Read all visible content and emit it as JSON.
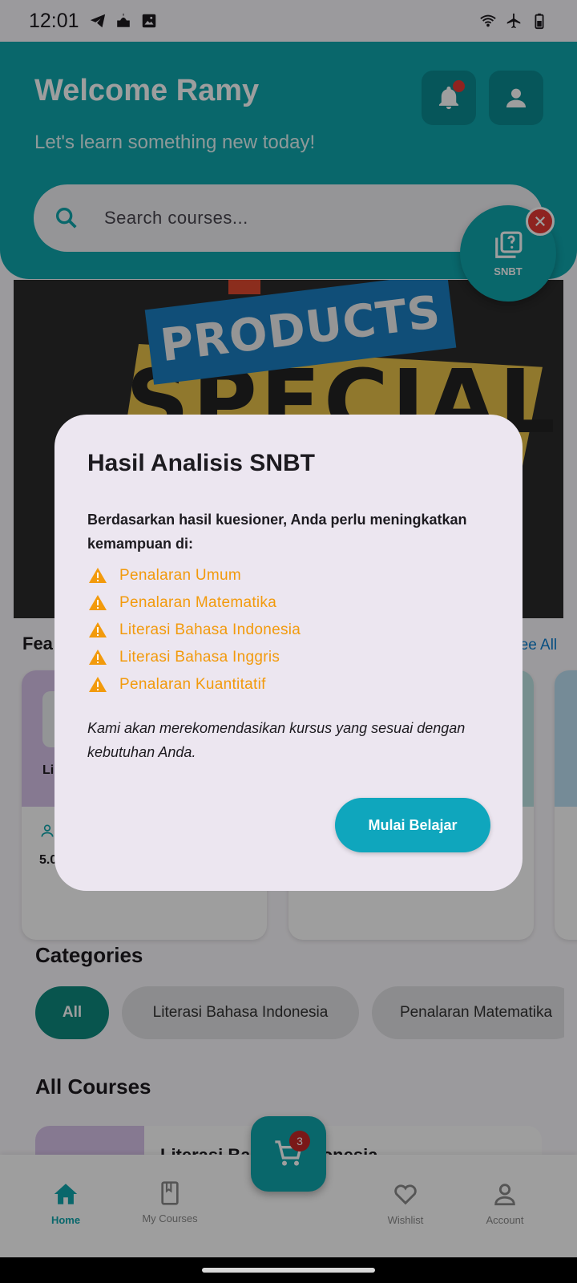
{
  "status_bar": {
    "time": "12:01"
  },
  "header": {
    "welcome": "Welcome Ramy",
    "subtitle": "Let's learn something new today!",
    "search_placeholder": "Search courses..."
  },
  "snbt_fab": {
    "label": "SNBT"
  },
  "banner": {
    "line1": "PRODUCTS",
    "line2": "SPECIAL"
  },
  "featured": {
    "title": "Fea",
    "see_all": "See All",
    "card1_text": "Li",
    "card1_rating": "5.0"
  },
  "categories": {
    "title": "Categories",
    "chips": [
      "All",
      "Literasi Bahasa Indonesia",
      "Penalaran Matematika"
    ]
  },
  "all_courses": {
    "title": "All Courses",
    "first_course": "Literasi Bahasa Indonesia"
  },
  "cart": {
    "count": "3"
  },
  "bottom_nav": {
    "home": "Home",
    "my_courses": "My Courses",
    "wishlist": "Wishlist",
    "account": "Account"
  },
  "dialog": {
    "title": "Hasil Analisis SNBT",
    "intro": "Berdasarkan hasil kuesioner, Anda perlu meningkatkan kemampuan di:",
    "items": [
      "Penalaran Umum",
      "Penalaran Matematika",
      "Literasi Bahasa Indonesia",
      "Literasi Bahasa Inggris",
      "Penalaran Kuantitatif"
    ],
    "note": "Kami akan merekomendasikan kursus yang sesuai dengan kebutuhan Anda.",
    "button": "Mulai Belajar"
  },
  "colors": {
    "primary": "#0fa6ad",
    "warning": "#f29a0c",
    "badge_red": "#e53935",
    "dialog_bg": "#ece6f0"
  }
}
